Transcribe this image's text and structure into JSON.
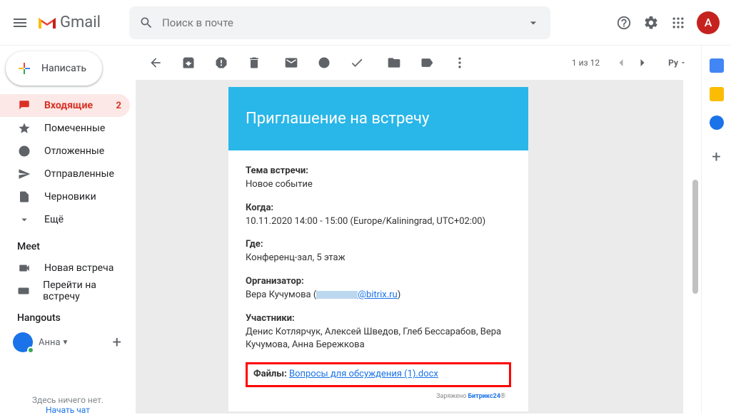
{
  "header": {
    "logo_text": "Gmail",
    "search_placeholder": "Поиск в почте",
    "avatar_letter": "А"
  },
  "compose_label": "Написать",
  "nav": [
    {
      "label": "Входящие",
      "badge": "2",
      "active": true
    },
    {
      "label": "Помеченные"
    },
    {
      "label": "Отложенные"
    },
    {
      "label": "Отправленные"
    },
    {
      "label": "Черновики"
    },
    {
      "label": "Ещё"
    }
  ],
  "meet": {
    "title": "Meet",
    "items": [
      "Новая встреча",
      "Перейти на встречу"
    ]
  },
  "hangouts": {
    "title": "Hangouts",
    "user": "Анна",
    "empty1": "Здесь ничего нет.",
    "empty2": "Начать чат"
  },
  "toolbar": {
    "count": "1 из 12",
    "lang": "Ру"
  },
  "email": {
    "title": "Приглашение на встречу",
    "subject_label": "Тема встречи:",
    "subject": "Новое событие",
    "when_label": "Когда:",
    "when": "10.11.2020 14:00 - 15:00 (Europe/Kaliningrad, UTC+02:00)",
    "where_label": "Где:",
    "where": "Конференц-зал, 5 этаж",
    "org_label": "Организатор:",
    "org_name": "Вера Кучумова (",
    "org_email": "@bitrix.ru",
    "org_close": ")",
    "part_label": "Участники:",
    "participants": "Денис Котлярчук, Алексей Шведов, Глеб Бессарабов, Вера Кучумова, Анна Бережкова",
    "files_label": "Файлы:",
    "file_link": "Вопросы для обсуждения (1).docx",
    "powered_prefix": "Заряжено ",
    "powered_brand": "Битрикс24",
    "powered_suffix": "®"
  }
}
